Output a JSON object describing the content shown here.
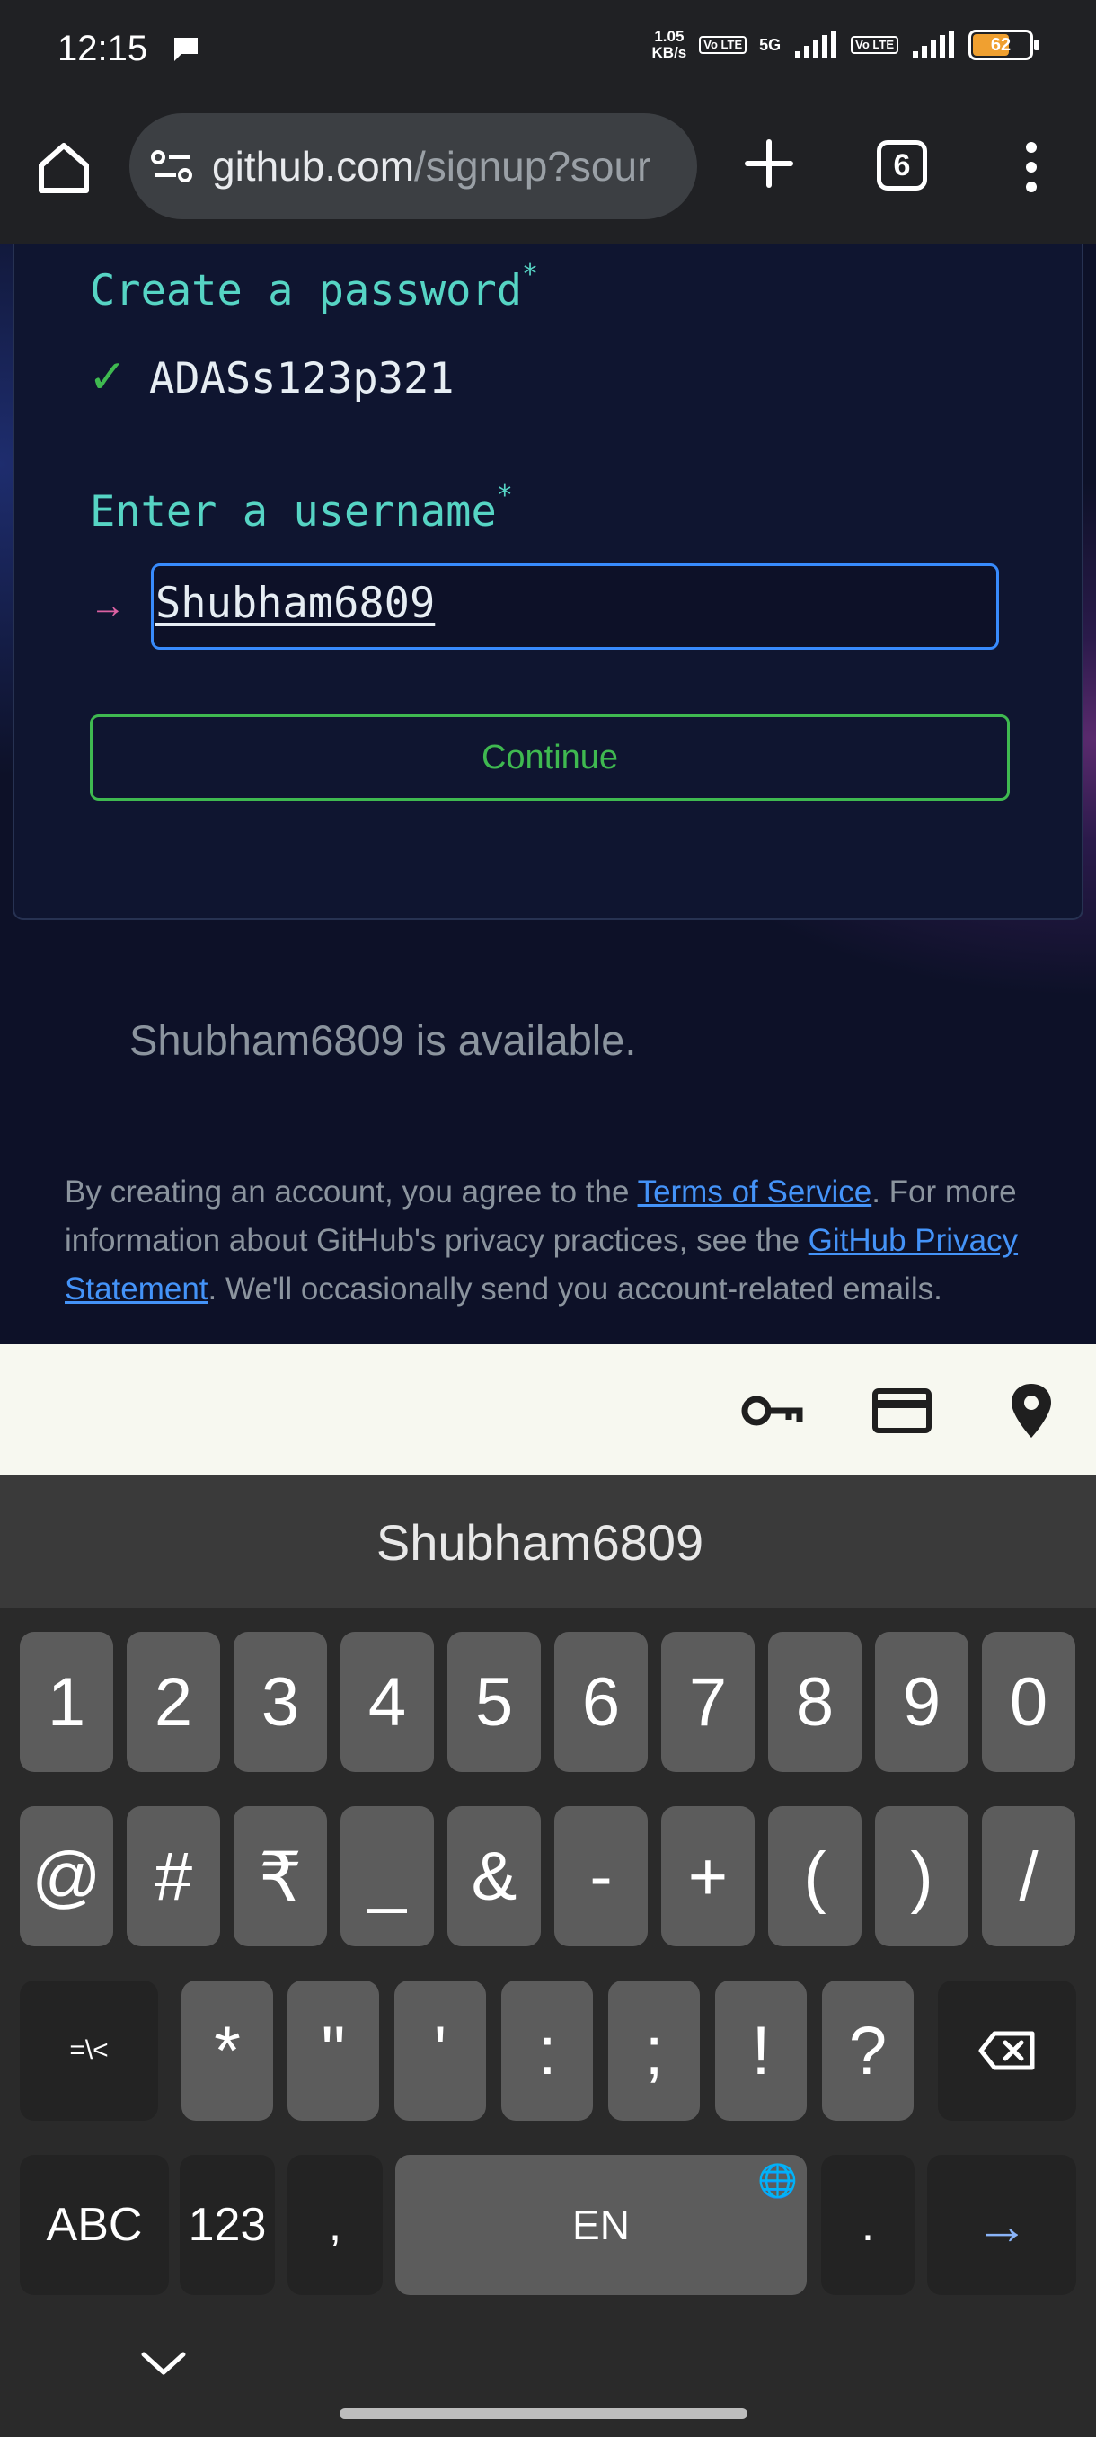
{
  "status_bar": {
    "time": "12:15",
    "speed_value": "1.05",
    "speed_unit": "KB/s",
    "volte1": "Vo LTE",
    "network": "5G",
    "volte2": "Vo LTE",
    "battery": "62"
  },
  "browser": {
    "url_host": "github.com",
    "url_path": "/signup?sour",
    "tab_count": "6"
  },
  "form": {
    "password_label": "Create a password",
    "required_mark": "*",
    "password_check": "✓",
    "password_value": "ADASs123p321",
    "username_label": "Enter a username",
    "username_arrow": "→",
    "username_value": "Shubham6809",
    "continue_label": "Continue",
    "availability": "Shubham6809 is available."
  },
  "legal": {
    "prefix": "By creating an account, you agree to the ",
    "terms_link": "Terms of Service",
    "middle": ". For more information about GitHub's privacy practices, see the ",
    "privacy_link": "GitHub Privacy Statement",
    "suffix": ". We'll occasionally send you account-related emails."
  },
  "autofill_icons": [
    "key-icon",
    "credit-card-icon",
    "location-pin-icon"
  ],
  "suggestion": "Shubham6809",
  "keyboard": {
    "row1": [
      "1",
      "2",
      "3",
      "4",
      "5",
      "6",
      "7",
      "8",
      "9",
      "0"
    ],
    "row2": [
      "@",
      "#",
      "₹",
      "_",
      "&",
      "-",
      "+",
      "(",
      ")",
      "/"
    ],
    "row3_mode": "=\\<",
    "row3": [
      "*",
      "\"",
      "'",
      ":",
      ";",
      "!",
      "?"
    ],
    "abc": "ABC",
    "num": "123",
    "comma": ",",
    "space": "EN",
    "period": ".",
    "enter": "→"
  }
}
